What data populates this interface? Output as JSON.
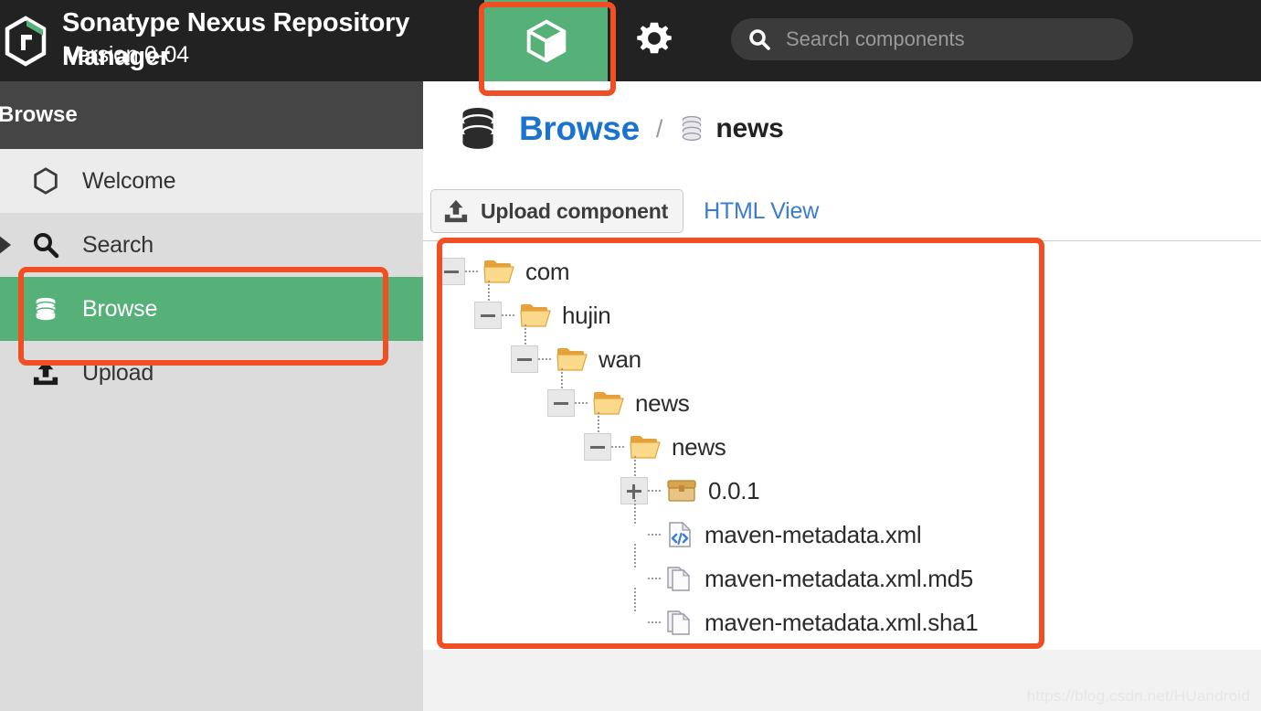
{
  "app": {
    "title": "Sonatype Nexus Repository Manager",
    "version": "Version 0-04",
    "logo_icon": "nexus-hexagon-logo"
  },
  "topbar": {
    "components_icon": "cube-icon",
    "settings_icon": "gear-icon",
    "search": {
      "icon": "search-icon",
      "placeholder": "Search components",
      "value": ""
    }
  },
  "sidebar": {
    "header": "Browse",
    "items": [
      {
        "label": "Welcome",
        "icon": "hexagon-icon",
        "selected": false
      },
      {
        "label": "Search",
        "icon": "search-icon",
        "selected": false
      },
      {
        "label": "Browse",
        "icon": "database-icon",
        "selected": true
      },
      {
        "label": "Upload",
        "icon": "upload-icon",
        "selected": false
      }
    ]
  },
  "main": {
    "breadcrumb": {
      "root_icon": "database-icon",
      "root_label": "Browse",
      "separator": "/",
      "current_icon": "database-icon",
      "current_label": "news"
    },
    "toolbar": {
      "upload_icon": "upload-icon",
      "upload_label": "Upload component",
      "html_view_label": "HTML View"
    },
    "tree": [
      {
        "label": "com",
        "icon": "folder-open-icon",
        "expander": "minus",
        "depth": 0
      },
      {
        "label": "hujin",
        "icon": "folder-open-icon",
        "expander": "minus",
        "depth": 1
      },
      {
        "label": "wan",
        "icon": "folder-open-icon",
        "expander": "minus",
        "depth": 2
      },
      {
        "label": "news",
        "icon": "folder-open-icon",
        "expander": "minus",
        "depth": 3
      },
      {
        "label": "news",
        "icon": "folder-open-icon",
        "expander": "minus",
        "depth": 4
      },
      {
        "label": "0.0.1",
        "icon": "package-icon",
        "expander": "plus",
        "depth": 5
      },
      {
        "label": "maven-metadata.xml",
        "icon": "xml-file-icon",
        "expander": "none",
        "depth": 5
      },
      {
        "label": "maven-metadata.xml.md5",
        "icon": "file-icon",
        "expander": "none",
        "depth": 5
      },
      {
        "label": "maven-metadata.xml.sha1",
        "icon": "file-icon",
        "expander": "none",
        "depth": 5
      }
    ]
  },
  "footer": {
    "watermark": "https://blog.csdn.net/HUandroid"
  },
  "colors": {
    "accent_green": "#56b179",
    "annotation_red": "#f04f23",
    "link_blue": "#1a73cf",
    "topbar_dark": "#222222",
    "sidebar_gray": "#dcdcdc"
  }
}
